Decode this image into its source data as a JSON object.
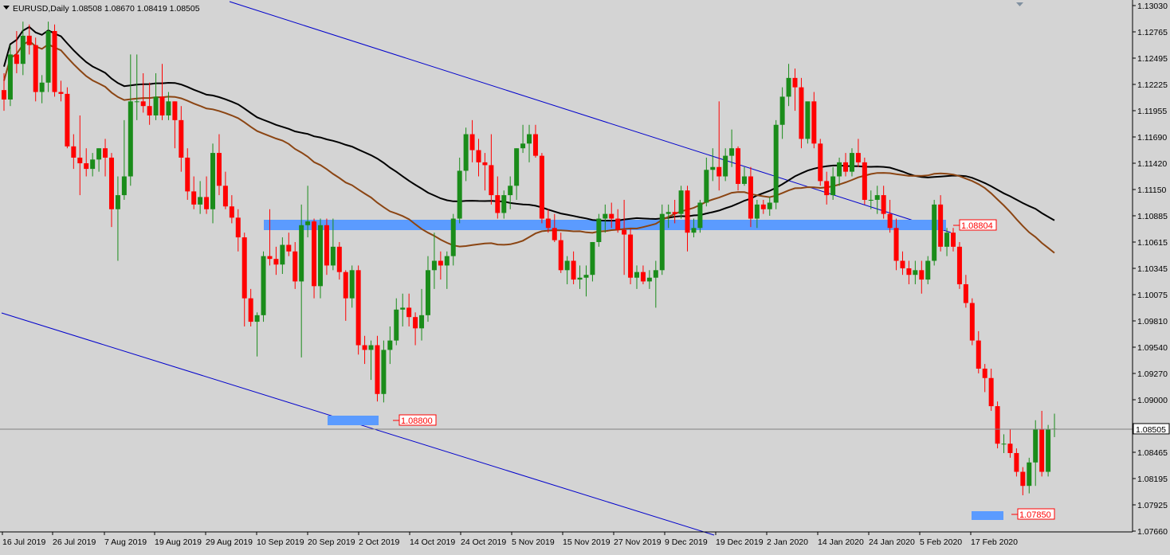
{
  "window": {
    "symbol_label": "EURUSD,Daily",
    "ohlc_label": "1.08508 1.08670 1.08419 1.08505"
  },
  "colors": {
    "background": "#d4d4d4",
    "bull": "#1a8c1a",
    "bear": "#ff0000",
    "trendline": "#0000cc",
    "ma_fast": "#8b4513",
    "ma_slow": "#000000",
    "zone": "#5b9bff",
    "price_line": "#808080"
  },
  "chart_data": {
    "type": "candlestick",
    "title": "EURUSD,Daily",
    "ohlc_readout": "1.08508 1.08670 1.08419 1.08505",
    "ylim": [
      1.0768,
      1.1314
    ],
    "y_ticks": [
      "1.13030",
      "1.12765",
      "1.12495",
      "1.12225",
      "1.11955",
      "1.11690",
      "1.11420",
      "1.11150",
      "1.10885",
      "1.10615",
      "1.10345",
      "1.10075",
      "1.09810",
      "1.09540",
      "1.09270",
      "1.09000",
      "1.08735",
      "1.08465",
      "1.08195",
      "1.07925",
      "1.07660"
    ],
    "x_ticks": [
      "16 Jul 2019",
      "26 Jul 2019",
      "7 Aug 2019",
      "19 Aug 2019",
      "29 Aug 2019",
      "10 Sep 2019",
      "20 Sep 2019",
      "2 Oct 2019",
      "14 Oct 2019",
      "24 Oct 2019",
      "5 Nov 2019",
      "15 Nov 2019",
      "27 Nov 2019",
      "9 Dec 2019",
      "19 Dec 2019",
      "2 Jan 2020",
      "14 Jan 2020",
      "24 Jan 2020",
      "5 Feb 2020",
      "17 Feb 2020"
    ],
    "current_price": "1.08505",
    "price_labels": [
      "1.08804",
      "1.08800",
      "1.07850"
    ],
    "candles_note": "",
    "candles": [
      [
        "2019-07-09",
        1.1212,
        1.123,
        1.119,
        1.1202
      ],
      [
        "2019-07-10",
        1.1202,
        1.126,
        1.1195,
        1.125
      ],
      [
        "2019-07-11",
        1.125,
        1.1275,
        1.123,
        1.124
      ],
      [
        "2019-07-12",
        1.124,
        1.1285,
        1.1228,
        1.127
      ],
      [
        "2019-07-15",
        1.127,
        1.1282,
        1.125,
        1.126
      ],
      [
        "2019-07-16",
        1.126,
        1.1268,
        1.12,
        1.121
      ],
      [
        "2019-07-17",
        1.121,
        1.1228,
        1.1198,
        1.122
      ],
      [
        "2019-07-18",
        1.122,
        1.1285,
        1.121,
        1.1275
      ],
      [
        "2019-07-19",
        1.1275,
        1.1282,
        1.1205,
        1.121
      ],
      [
        "2019-07-22",
        1.121,
        1.1222,
        1.12,
        1.1208
      ],
      [
        "2019-07-23",
        1.1208,
        1.1215,
        1.115,
        1.1152
      ],
      [
        "2019-07-24",
        1.1152,
        1.1165,
        1.1128,
        1.114
      ],
      [
        "2019-07-25",
        1.114,
        1.1185,
        1.11,
        1.1134
      ],
      [
        "2019-07-26",
        1.1134,
        1.115,
        1.112,
        1.1128
      ],
      [
        "2019-07-29",
        1.1128,
        1.1145,
        1.112,
        1.1138
      ],
      [
        "2019-07-30",
        1.1138,
        1.115,
        1.1125,
        1.115
      ],
      [
        "2019-07-31",
        1.115,
        1.116,
        1.112,
        1.114
      ],
      [
        "2019-08-01",
        1.114,
        1.1145,
        1.1066,
        1.1085
      ],
      [
        "2019-08-02",
        1.1085,
        1.112,
        1.103,
        1.11
      ],
      [
        "2019-08-05",
        1.11,
        1.118,
        1.1095,
        1.112
      ],
      [
        "2019-08-06",
        1.112,
        1.125,
        1.111,
        1.12
      ],
      [
        "2019-08-07",
        1.12,
        1.125,
        1.118,
        1.12
      ],
      [
        "2019-08-08",
        1.12,
        1.123,
        1.1188,
        1.1195
      ],
      [
        "2019-08-09",
        1.1195,
        1.122,
        1.1175,
        1.1185
      ],
      [
        "2019-08-12",
        1.1185,
        1.123,
        1.118,
        1.1205
      ],
      [
        "2019-08-13",
        1.1205,
        1.124,
        1.118,
        1.1185
      ],
      [
        "2019-08-14",
        1.1185,
        1.121,
        1.118,
        1.12
      ],
      [
        "2019-08-15",
        1.12,
        1.12,
        1.115,
        1.118
      ],
      [
        "2019-08-16",
        1.118,
        1.1195,
        1.1125,
        1.114
      ],
      [
        "2019-08-19",
        1.114,
        1.115,
        1.1095,
        1.1104
      ],
      [
        "2019-08-20",
        1.1104,
        1.112,
        1.1085,
        1.109
      ],
      [
        "2019-08-21",
        1.109,
        1.1115,
        1.108,
        1.1098
      ],
      [
        "2019-08-22",
        1.1098,
        1.112,
        1.108,
        1.1085
      ],
      [
        "2019-08-23",
        1.1085,
        1.1155,
        1.107,
        1.1145
      ],
      [
        "2019-08-26",
        1.1145,
        1.1165,
        1.11,
        1.111
      ],
      [
        "2019-08-27",
        1.111,
        1.1125,
        1.1085,
        1.1088
      ],
      [
        "2019-08-28",
        1.1088,
        1.11,
        1.107,
        1.1076
      ],
      [
        "2019-08-29",
        1.1076,
        1.1085,
        1.104,
        1.1055
      ],
      [
        "2019-08-30",
        1.1055,
        1.106,
        1.096,
        1.099
      ],
      [
        "2019-09-02",
        1.099,
        1.1,
        1.096,
        1.0965
      ],
      [
        "2019-09-03",
        1.0965,
        1.0975,
        1.0928,
        1.0972
      ],
      [
        "2019-09-04",
        1.0972,
        1.104,
        1.0965,
        1.1035
      ],
      [
        "2019-09-05",
        1.1035,
        1.1085,
        1.1025,
        1.1032
      ],
      [
        "2019-09-06",
        1.1032,
        1.1045,
        1.1015,
        1.1026
      ],
      [
        "2019-09-09",
        1.1026,
        1.1055,
        1.1016,
        1.1047
      ],
      [
        "2019-09-10",
        1.1047,
        1.106,
        1.1035,
        1.104
      ],
      [
        "2019-09-11",
        1.104,
        1.105,
        1.1,
        1.1008
      ],
      [
        "2019-09-12",
        1.1008,
        1.109,
        1.0927,
        1.1068
      ],
      [
        "2019-09-13",
        1.1068,
        1.111,
        1.1055,
        1.1072
      ],
      [
        "2019-09-16",
        1.1072,
        1.1075,
        1.099,
        1.1003
      ],
      [
        "2019-09-17",
        1.1003,
        1.1075,
        1.099,
        1.1068
      ],
      [
        "2019-09-18",
        1.1068,
        1.1075,
        1.1015,
        1.1025
      ],
      [
        "2019-09-19",
        1.1025,
        1.1075,
        1.102,
        1.1045
      ],
      [
        "2019-09-20",
        1.1045,
        1.105,
        1.101,
        1.1018
      ],
      [
        "2019-09-23",
        1.1018,
        1.102,
        1.0966,
        1.099
      ],
      [
        "2019-09-24",
        1.099,
        1.1025,
        1.098,
        1.102
      ],
      [
        "2019-09-25",
        1.102,
        1.1025,
        1.093,
        1.094
      ],
      [
        "2019-09-26",
        1.094,
        1.095,
        1.092,
        1.0935
      ],
      [
        "2019-09-27",
        1.0935,
        1.0945,
        1.0903,
        1.094
      ],
      [
        "2019-09-30",
        1.094,
        1.095,
        1.088,
        1.0888
      ],
      [
        "2019-10-01",
        1.0888,
        1.0945,
        1.0879,
        1.0935
      ],
      [
        "2019-10-02",
        1.0935,
        1.096,
        1.092,
        1.0945
      ],
      [
        "2019-10-03",
        1.0945,
        1.099,
        1.094,
        1.0978
      ],
      [
        "2019-10-04",
        1.0978,
        1.0995,
        1.096,
        1.098
      ],
      [
        "2019-10-07",
        1.098,
        1.0995,
        1.096,
        1.097
      ],
      [
        "2019-10-08",
        1.097,
        1.0975,
        1.094,
        1.0958
      ],
      [
        "2019-10-09",
        1.0958,
        1.1,
        1.0945,
        1.0972
      ],
      [
        "2019-10-10",
        1.0972,
        1.1035,
        1.0965,
        1.102
      ],
      [
        "2019-10-11",
        1.102,
        1.106,
        1.1,
        1.103
      ],
      [
        "2019-10-14",
        1.103,
        1.104,
        1.101,
        1.1025
      ],
      [
        "2019-10-15",
        1.1025,
        1.104,
        1.1,
        1.1035
      ],
      [
        "2019-10-16",
        1.1035,
        1.108,
        1.1025,
        1.1075
      ],
      [
        "2019-10-17",
        1.1075,
        1.114,
        1.107,
        1.1126
      ],
      [
        "2019-10-18",
        1.1126,
        1.1172,
        1.1115,
        1.1165
      ],
      [
        "2019-10-21",
        1.1165,
        1.118,
        1.1135,
        1.1148
      ],
      [
        "2019-10-22",
        1.1148,
        1.116,
        1.112,
        1.1135
      ],
      [
        "2019-10-23",
        1.1135,
        1.1145,
        1.1105,
        1.1132
      ],
      [
        "2019-10-24",
        1.1132,
        1.1165,
        1.109,
        1.11
      ],
      [
        "2019-10-25",
        1.11,
        1.112,
        1.1075,
        1.1081
      ],
      [
        "2019-10-28",
        1.1081,
        1.1105,
        1.1075,
        1.11
      ],
      [
        "2019-10-29",
        1.11,
        1.112,
        1.1085,
        1.111
      ],
      [
        "2019-10-30",
        1.111,
        1.115,
        1.1095,
        1.115
      ],
      [
        "2019-10-31",
        1.115,
        1.1175,
        1.1145,
        1.1155
      ],
      [
        "2019-11-01",
        1.1155,
        1.1175,
        1.1135,
        1.1165
      ],
      [
        "2019-11-04",
        1.1165,
        1.1175,
        1.114,
        1.1142
      ],
      [
        "2019-11-05",
        1.1142,
        1.1145,
        1.107,
        1.1075
      ],
      [
        "2019-11-06",
        1.1075,
        1.1085,
        1.106,
        1.1065
      ],
      [
        "2019-11-07",
        1.1065,
        1.108,
        1.105,
        1.1052
      ],
      [
        "2019-11-08",
        1.1052,
        1.106,
        1.1017,
        1.102
      ],
      [
        "2019-11-11",
        1.102,
        1.1035,
        1.1005,
        1.103
      ],
      [
        "2019-11-12",
        1.103,
        1.104,
        1.1005,
        1.101
      ],
      [
        "2019-11-13",
        1.101,
        1.1025,
        1.1,
        1.1012
      ],
      [
        "2019-11-14",
        1.1012,
        1.1025,
        1.0992,
        1.1015
      ],
      [
        "2019-11-15",
        1.1015,
        1.105,
        1.1008,
        1.105
      ],
      [
        "2019-11-18",
        1.105,
        1.108,
        1.1045,
        1.1075
      ],
      [
        "2019-11-19",
        1.1075,
        1.109,
        1.106,
        1.108
      ],
      [
        "2019-11-20",
        1.108,
        1.1092,
        1.1065,
        1.1075
      ],
      [
        "2019-11-21",
        1.1075,
        1.1085,
        1.106,
        1.1063
      ],
      [
        "2019-11-22",
        1.1063,
        1.1095,
        1.1015,
        1.1058
      ],
      [
        "2019-11-25",
        1.1058,
        1.1064,
        1.1005,
        1.1012
      ],
      [
        "2019-11-26",
        1.1012,
        1.1025,
        1.1,
        1.1018
      ],
      [
        "2019-11-27",
        1.1018,
        1.1025,
        1.1005,
        1.1008
      ],
      [
        "2019-11-28",
        1.1008,
        1.102,
        1.1,
        1.1012
      ],
      [
        "2019-11-29",
        1.1012,
        1.103,
        1.098,
        1.102
      ],
      [
        "2019-12-02",
        1.102,
        1.109,
        1.1015,
        1.108
      ],
      [
        "2019-12-03",
        1.108,
        1.109,
        1.1065,
        1.1082
      ],
      [
        "2019-12-04",
        1.1082,
        1.1095,
        1.107,
        1.108
      ],
      [
        "2019-12-05",
        1.108,
        1.111,
        1.1075,
        1.1105
      ],
      [
        "2019-12-06",
        1.1105,
        1.111,
        1.104,
        1.106
      ],
      [
        "2019-12-09",
        1.106,
        1.1075,
        1.1055,
        1.1065
      ],
      [
        "2019-12-10",
        1.1065,
        1.1095,
        1.106,
        1.1092
      ],
      [
        "2019-12-11",
        1.1092,
        1.114,
        1.1088,
        1.1127
      ],
      [
        "2019-12-12",
        1.1127,
        1.115,
        1.1115,
        1.113
      ],
      [
        "2019-12-13",
        1.113,
        1.12,
        1.1105,
        1.112
      ],
      [
        "2019-12-16",
        1.112,
        1.115,
        1.1115,
        1.1142
      ],
      [
        "2019-12-17",
        1.1142,
        1.117,
        1.113,
        1.115
      ],
      [
        "2019-12-18",
        1.115,
        1.1152,
        1.1105,
        1.1112
      ],
      [
        "2019-12-19",
        1.1112,
        1.113,
        1.111,
        1.112
      ],
      [
        "2019-12-20",
        1.112,
        1.113,
        1.1066,
        1.1075
      ],
      [
        "2019-12-23",
        1.1075,
        1.1095,
        1.1065,
        1.109
      ],
      [
        "2019-12-24",
        1.109,
        1.1095,
        1.108,
        1.1085
      ],
      [
        "2019-12-26",
        1.1085,
        1.1098,
        1.1078,
        1.1092
      ],
      [
        "2019-12-27",
        1.1092,
        1.118,
        1.1085,
        1.1175
      ],
      [
        "2019-12-30",
        1.1175,
        1.1215,
        1.116,
        1.1205
      ],
      [
        "2019-12-31",
        1.1205,
        1.124,
        1.1195,
        1.1225
      ],
      [
        "2020-01-02",
        1.1225,
        1.1235,
        1.119,
        1.1215
      ],
      [
        "2020-01-03",
        1.1215,
        1.1225,
        1.115,
        1.116
      ],
      [
        "2020-01-06",
        1.116,
        1.118,
        1.1155,
        1.12
      ],
      [
        "2020-01-07",
        1.12,
        1.121,
        1.115,
        1.1155
      ],
      [
        "2020-01-08",
        1.1155,
        1.116,
        1.111,
        1.1115
      ],
      [
        "2020-01-09",
        1.1115,
        1.1125,
        1.109,
        1.11
      ],
      [
        "2020-01-10",
        1.11,
        1.113,
        1.1095,
        1.112
      ],
      [
        "2020-01-13",
        1.112,
        1.114,
        1.111,
        1.1135
      ],
      [
        "2020-01-14",
        1.1135,
        1.1145,
        1.112,
        1.1125
      ],
      [
        "2020-01-15",
        1.1125,
        1.115,
        1.112,
        1.1145
      ],
      [
        "2020-01-16",
        1.1145,
        1.116,
        1.113,
        1.1135
      ],
      [
        "2020-01-17",
        1.1135,
        1.114,
        1.109,
        1.1095
      ],
      [
        "2020-01-20",
        1.1095,
        1.1105,
        1.1085,
        1.1095
      ],
      [
        "2020-01-21",
        1.1095,
        1.111,
        1.108,
        1.11
      ],
      [
        "2020-01-22",
        1.11,
        1.111,
        1.1075,
        1.108
      ],
      [
        "2020-01-23",
        1.108,
        1.1095,
        1.106,
        1.1065
      ],
      [
        "2020-01-24",
        1.1065,
        1.1075,
        1.102,
        1.103
      ],
      [
        "2020-01-27",
        1.103,
        1.104,
        1.1015,
        1.1022
      ],
      [
        "2020-01-28",
        1.1022,
        1.103,
        1.1005,
        1.1015
      ],
      [
        "2020-01-29",
        1.1015,
        1.103,
        1.1005,
        1.102
      ],
      [
        "2020-01-30",
        1.102,
        1.103,
        1.0995,
        1.101
      ],
      [
        "2020-01-31",
        1.101,
        1.1035,
        1.1005,
        1.103
      ],
      [
        "2020-02-03",
        1.103,
        1.1095,
        1.1025,
        1.109
      ],
      [
        "2020-02-04",
        1.109,
        1.11,
        1.104,
        1.1045
      ],
      [
        "2020-02-05",
        1.1045,
        1.1065,
        1.1035,
        1.106
      ],
      [
        "2020-02-06",
        1.106,
        1.1065,
        1.104,
        1.1045
      ],
      [
        "2020-02-07",
        1.1045,
        1.105,
        1.1,
        1.1005
      ],
      [
        "2020-02-10",
        1.1005,
        1.1015,
        1.098,
        1.0985
      ],
      [
        "2020-02-11",
        1.0985,
        1.099,
        1.094,
        1.0945
      ],
      [
        "2020-02-12",
        1.0945,
        1.0955,
        1.091,
        1.0915
      ],
      [
        "2020-02-13",
        1.0915,
        1.092,
        1.089,
        1.0905
      ],
      [
        "2020-02-14",
        1.0905,
        1.0915,
        1.087,
        1.0875
      ],
      [
        "2020-02-17",
        1.0875,
        1.088,
        1.083,
        1.0835
      ],
      [
        "2020-02-18",
        1.0835,
        1.0845,
        1.0825,
        1.0835
      ],
      [
        "2020-02-19",
        1.0835,
        1.085,
        1.082,
        1.0825
      ],
      [
        "2020-02-20",
        1.0825,
        1.083,
        1.08,
        1.0805
      ],
      [
        "2020-02-21",
        1.0805,
        1.081,
        1.078,
        1.079
      ],
      [
        "2020-02-24",
        1.079,
        1.082,
        1.0782,
        1.0815
      ],
      [
        "2020-02-25",
        1.0815,
        1.086,
        1.079,
        1.085
      ],
      [
        "2020-02-26",
        1.085,
        1.087,
        1.08,
        1.0805
      ],
      [
        "2020-02-27",
        1.0805,
        1.0855,
        1.08,
        1.085
      ],
      [
        "2020-02-28",
        1.0851,
        1.0867,
        1.0842,
        1.0851
      ]
    ],
    "indicators": [
      {
        "name": "",
        "color": "#000000"
      },
      {
        "name": "",
        "color": "#8b4513"
      }
    ]
  }
}
